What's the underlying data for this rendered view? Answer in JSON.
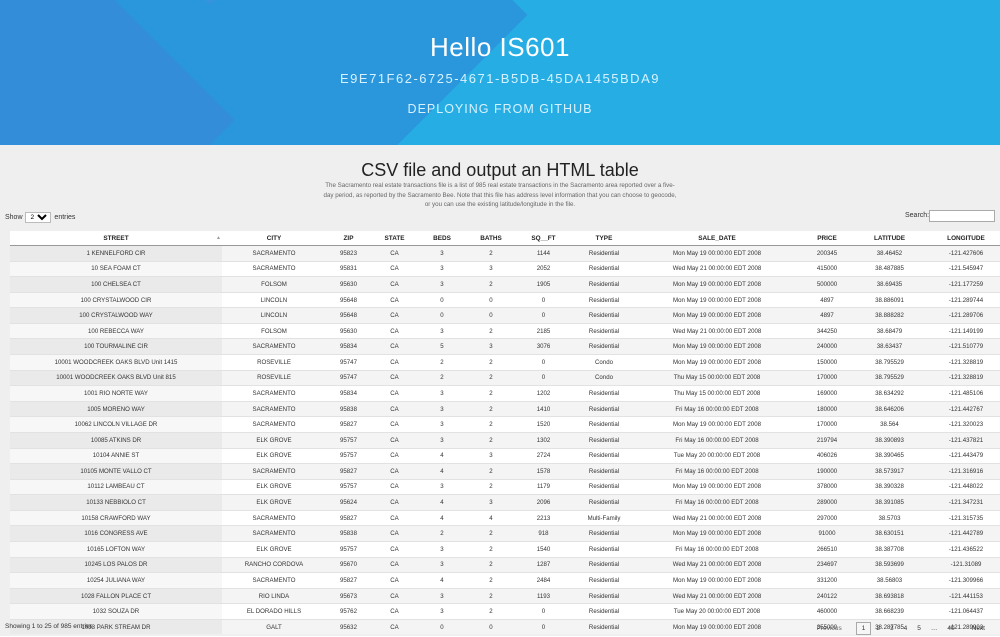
{
  "header": {
    "title": "Hello IS601",
    "guid": "E9E71F62-6725-4671-B5DB-45DA1455BDA9",
    "subtitle": "DEPLOYING FROM GITHUB"
  },
  "section": {
    "title": "CSV file and output an HTML table",
    "description": "The Sacramento real estate transactions file is a list of 985 real estate transactions in the Sacramento area reported over a five-day period, as reported by the Sacramento Bee. Note that this file has address level information that you can choose to geocode, or you can use the existing latitude/longitude in the file."
  },
  "length_control": {
    "show_label": "Show",
    "selected": "25",
    "entries_label": "entries"
  },
  "search": {
    "label": "Search:",
    "value": ""
  },
  "table": {
    "columns": [
      "STREET",
      "CITY",
      "ZIP",
      "STATE",
      "BEDS",
      "BATHS",
      "SQ__FT",
      "TYPE",
      "SALE_DATE",
      "PRICE",
      "LATITUDE",
      "LONGITUDE"
    ],
    "rows": [
      [
        "1 KENNELFORD CIR",
        "SACRAMENTO",
        "95823",
        "CA",
        "3",
        "2",
        "1144",
        "Residential",
        "Mon May 19 00:00:00 EDT 2008",
        "200345",
        "38.46452",
        "-121.427606"
      ],
      [
        "10 SEA FOAM CT",
        "SACRAMENTO",
        "95831",
        "CA",
        "3",
        "3",
        "2052",
        "Residential",
        "Wed May 21 00:00:00 EDT 2008",
        "415000",
        "38.487885",
        "-121.545947"
      ],
      [
        "100 CHELSEA CT",
        "FOLSOM",
        "95630",
        "CA",
        "3",
        "2",
        "1905",
        "Residential",
        "Mon May 19 00:00:00 EDT 2008",
        "500000",
        "38.69435",
        "-121.177259"
      ],
      [
        "100 CRYSTALWOOD CIR",
        "LINCOLN",
        "95648",
        "CA",
        "0",
        "0",
        "0",
        "Residential",
        "Mon May 19 00:00:00 EDT 2008",
        "4897",
        "38.886091",
        "-121.289744"
      ],
      [
        "100 CRYSTALWOOD WAY",
        "LINCOLN",
        "95648",
        "CA",
        "0",
        "0",
        "0",
        "Residential",
        "Mon May 19 00:00:00 EDT 2008",
        "4897",
        "38.888282",
        "-121.289706"
      ],
      [
        "100 REBECCA WAY",
        "FOLSOM",
        "95630",
        "CA",
        "3",
        "2",
        "2185",
        "Residential",
        "Wed May 21 00:00:00 EDT 2008",
        "344250",
        "38.68479",
        "-121.149199"
      ],
      [
        "100 TOURMALINE CIR",
        "SACRAMENTO",
        "95834",
        "CA",
        "5",
        "3",
        "3076",
        "Residential",
        "Mon May 19 00:00:00 EDT 2008",
        "240000",
        "38.63437",
        "-121.510779"
      ],
      [
        "10001 WOODCREEK OAKS BLVD Unit 1415",
        "ROSEVILLE",
        "95747",
        "CA",
        "2",
        "2",
        "0",
        "Condo",
        "Mon May 19 00:00:00 EDT 2008",
        "150000",
        "38.795529",
        "-121.328819"
      ],
      [
        "10001 WOODCREEK OAKS BLVD Unit 815",
        "ROSEVILLE",
        "95747",
        "CA",
        "2",
        "2",
        "0",
        "Condo",
        "Thu May 15 00:00:00 EDT 2008",
        "170000",
        "38.795529",
        "-121.328819"
      ],
      [
        "1001 RIO NORTE WAY",
        "SACRAMENTO",
        "95834",
        "CA",
        "3",
        "2",
        "1202",
        "Residential",
        "Thu May 15 00:00:00 EDT 2008",
        "169000",
        "38.634292",
        "-121.485106"
      ],
      [
        "1005 MORENO WAY",
        "SACRAMENTO",
        "95838",
        "CA",
        "3",
        "2",
        "1410",
        "Residential",
        "Fri May 16 00:00:00 EDT 2008",
        "180000",
        "38.646206",
        "-121.442767"
      ],
      [
        "10062 LINCOLN VILLAGE DR",
        "SACRAMENTO",
        "95827",
        "CA",
        "3",
        "2",
        "1520",
        "Residential",
        "Mon May 19 00:00:00 EDT 2008",
        "170000",
        "38.564",
        "-121.320023"
      ],
      [
        "10085 ATKINS DR",
        "ELK GROVE",
        "95757",
        "CA",
        "3",
        "2",
        "1302",
        "Residential",
        "Fri May 16 00:00:00 EDT 2008",
        "219794",
        "38.390893",
        "-121.437821"
      ],
      [
        "10104 ANNIE ST",
        "ELK GROVE",
        "95757",
        "CA",
        "4",
        "3",
        "2724",
        "Residential",
        "Tue May 20 00:00:00 EDT 2008",
        "406026",
        "38.390465",
        "-121.443479"
      ],
      [
        "10105 MONTE VALLO CT",
        "SACRAMENTO",
        "95827",
        "CA",
        "4",
        "2",
        "1578",
        "Residential",
        "Fri May 16 00:00:00 EDT 2008",
        "190000",
        "38.573917",
        "-121.316916"
      ],
      [
        "10112 LAMBEAU CT",
        "ELK GROVE",
        "95757",
        "CA",
        "3",
        "2",
        "1179",
        "Residential",
        "Mon May 19 00:00:00 EDT 2008",
        "378000",
        "38.390328",
        "-121.448022"
      ],
      [
        "10133 NEBBIOLO CT",
        "ELK GROVE",
        "95624",
        "CA",
        "4",
        "3",
        "2096",
        "Residential",
        "Fri May 16 00:00:00 EDT 2008",
        "289000",
        "38.391085",
        "-121.347231"
      ],
      [
        "10158 CRAWFORD WAY",
        "SACRAMENTO",
        "95827",
        "CA",
        "4",
        "4",
        "2213",
        "Multi-Family",
        "Wed May 21 00:00:00 EDT 2008",
        "297000",
        "38.5703",
        "-121.315735"
      ],
      [
        "1016 CONGRESS AVE",
        "SACRAMENTO",
        "95838",
        "CA",
        "2",
        "2",
        "918",
        "Residential",
        "Mon May 19 00:00:00 EDT 2008",
        "91000",
        "38.630151",
        "-121.442789"
      ],
      [
        "10165 LOFTON WAY",
        "ELK GROVE",
        "95757",
        "CA",
        "3",
        "2",
        "1540",
        "Residential",
        "Fri May 16 00:00:00 EDT 2008",
        "266510",
        "38.387708",
        "-121.436522"
      ],
      [
        "10245 LOS PALOS DR",
        "RANCHO CORDOVA",
        "95670",
        "CA",
        "3",
        "2",
        "1287",
        "Residential",
        "Wed May 21 00:00:00 EDT 2008",
        "234697",
        "38.593699",
        "-121.31089"
      ],
      [
        "10254 JULIANA WAY",
        "SACRAMENTO",
        "95827",
        "CA",
        "4",
        "2",
        "2484",
        "Residential",
        "Mon May 19 00:00:00 EDT 2008",
        "331200",
        "38.56803",
        "-121.309966"
      ],
      [
        "1028 FALLON PLACE CT",
        "RIO LINDA",
        "95673",
        "CA",
        "3",
        "2",
        "1193",
        "Residential",
        "Wed May 21 00:00:00 EDT 2008",
        "240122",
        "38.693818",
        "-121.441153"
      ],
      [
        "1032 SOUZA DR",
        "EL DORADO HILLS",
        "95762",
        "CA",
        "3",
        "2",
        "0",
        "Residential",
        "Tue May 20 00:00:00 EDT 2008",
        "460000",
        "38.668239",
        "-121.064437"
      ],
      [
        "1033 PARK STREAM DR",
        "GALT",
        "95632",
        "CA",
        "0",
        "0",
        "0",
        "Residential",
        "Mon May 19 00:00:00 EDT 2008",
        "355000",
        "38.287785",
        "-121.289903"
      ]
    ]
  },
  "info": "Showing 1 to 25 of 985 entries",
  "pagination": {
    "previous": "Previous",
    "pages": [
      "1",
      "2",
      "3",
      "4",
      "5",
      "…",
      "40"
    ],
    "current": "1",
    "next": "Next"
  }
}
